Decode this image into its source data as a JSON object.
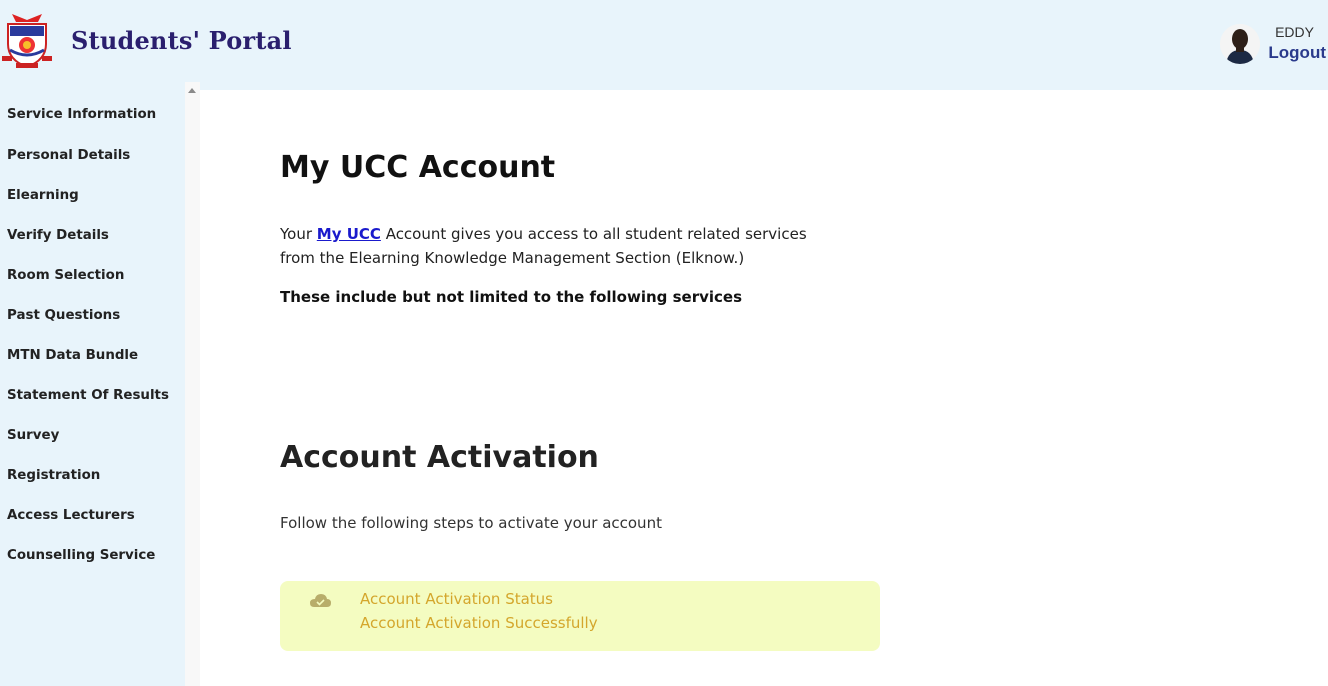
{
  "header": {
    "brand": "Students' Portal",
    "user_name": "EDDY",
    "logout_label": "Logout"
  },
  "sidebar": {
    "items": [
      {
        "label": "Service Information"
      },
      {
        "label": "Personal Details"
      },
      {
        "label": "Elearning"
      },
      {
        "label": "Verify Details"
      },
      {
        "label": "Room Selection"
      },
      {
        "label": "Past Questions"
      },
      {
        "label": "MTN Data Bundle"
      },
      {
        "label": "Statement Of Results"
      },
      {
        "label": "Survey"
      },
      {
        "label": "Registration"
      },
      {
        "label": "Access Lecturers"
      },
      {
        "label": "Counselling Service"
      }
    ]
  },
  "main": {
    "title": "My UCC Account",
    "intro_prefix": "Your ",
    "intro_link": "My UCC",
    "intro_suffix": " Account gives you access to all student related services from the Elearning Knowledge Management Section (Elknow.)",
    "services_note": "These include but not limited to the following services",
    "activation_title": "Account Activation",
    "activation_steps": "Follow the following steps to activate your account",
    "status": {
      "title": "Account Activation Status",
      "message": "Account Activation Successfully",
      "icon": "cloud-check-icon",
      "bg_color": "#f4fcc1",
      "text_color": "#d4a62c"
    }
  },
  "colors": {
    "header_bg": "#e8f4fb",
    "brand_color": "#2a1f6e",
    "link_color": "#1a1acc"
  }
}
